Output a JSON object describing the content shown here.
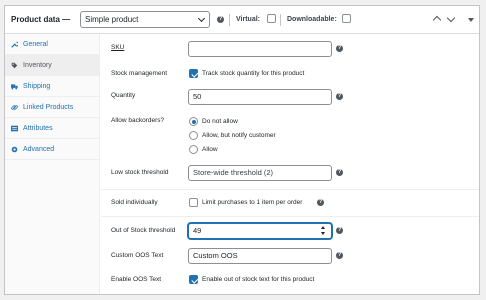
{
  "header": {
    "title": "Product data —",
    "product_type": "Simple product",
    "virtual_label": "Virtual:",
    "downloadable_label": "Downloadable:"
  },
  "sidebar": {
    "items": [
      {
        "label": "General",
        "icon": "wrench-icon"
      },
      {
        "label": "Inventory",
        "icon": "tag-icon"
      },
      {
        "label": "Shipping",
        "icon": "truck-icon"
      },
      {
        "label": "Linked Products",
        "icon": "link-icon"
      },
      {
        "label": "Attributes",
        "icon": "list-icon"
      },
      {
        "label": "Advanced",
        "icon": "gear-icon"
      }
    ]
  },
  "fields": {
    "sku": {
      "label": "SKU",
      "value": ""
    },
    "stock_management": {
      "label": "Stock management",
      "option": "Track stock quantity for this product",
      "checked": true
    },
    "quantity": {
      "label": "Quantity",
      "value": "50"
    },
    "backorders": {
      "label": "Allow backorders?",
      "options": [
        "Do not allow",
        "Allow, but notify customer",
        "Allow"
      ],
      "selected": "Do not allow"
    },
    "low_stock": {
      "label": "Low stock threshold",
      "placeholder": "Store-wide threshold (2)"
    },
    "sold_individually": {
      "label": "Sold individually",
      "option": "Limit purchases to 1 item per order",
      "checked": false
    },
    "oos_threshold": {
      "label": "Out of Stock threshold",
      "value": "49"
    },
    "custom_oos_text": {
      "label": "Custom OOS Text",
      "value": "Custom OOS"
    },
    "enable_oos_text": {
      "label": "Enable OOS Text",
      "option": "Enable out of stock text for this product",
      "checked": true
    }
  },
  "colors": {
    "accent": "#2271b1",
    "link": "#2271b1",
    "border": "#8c8f94"
  }
}
